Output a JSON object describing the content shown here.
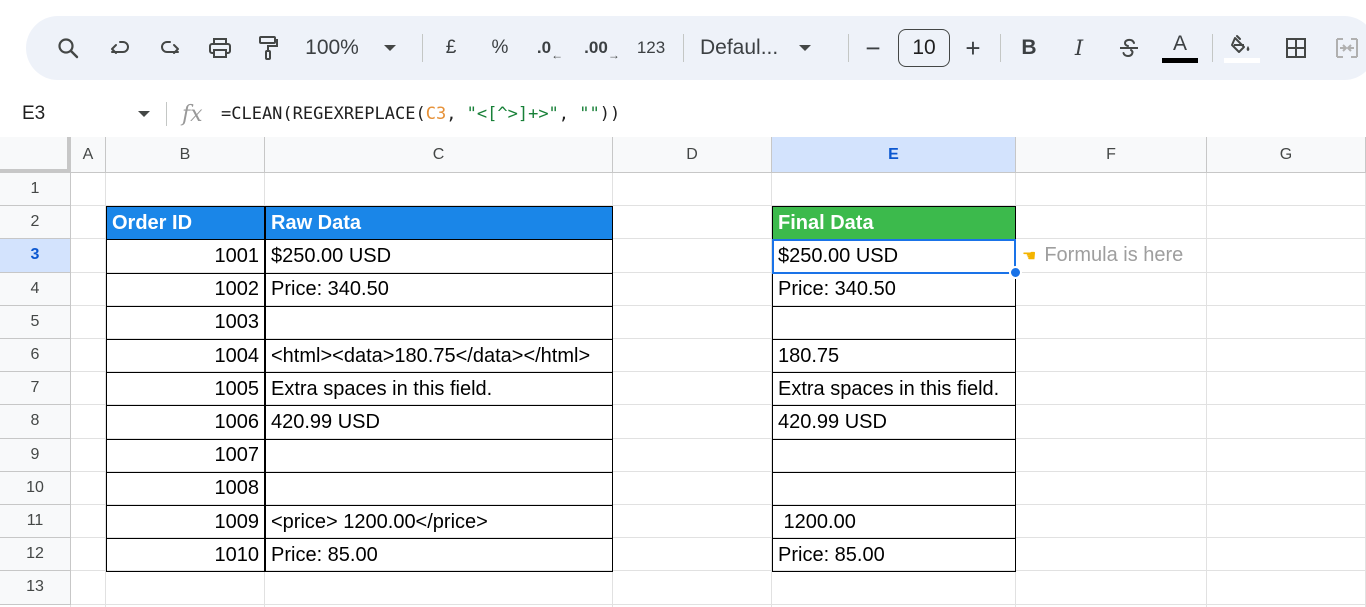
{
  "toolbar": {
    "zoom": "100%",
    "currency": "£",
    "percent": "%",
    "decrease_decimal": ".0",
    "increase_decimal": ".00",
    "number_format": "123",
    "font": "Defaul...",
    "font_size": "10",
    "bold": "B",
    "italic": "I",
    "text_color_glyph": "A",
    "minus": "−",
    "plus": "+"
  },
  "formula_bar": {
    "name_box": "E3",
    "fx": "fx",
    "formula_pre": "=CLEAN(REGEXREPLACE(",
    "formula_ref": "C3",
    "formula_mid": ", ",
    "formula_str1": "\"<[^>]+>\"",
    "formula_sep": ", ",
    "formula_str2": "\"\"",
    "formula_post": "))"
  },
  "columns": [
    "A",
    "B",
    "C",
    "D",
    "E",
    "F",
    "G"
  ],
  "selected_column": "E",
  "rows": [
    "1",
    "2",
    "3",
    "4",
    "5",
    "6",
    "7",
    "8",
    "9",
    "10",
    "11",
    "12",
    "13"
  ],
  "selected_row": "3",
  "headers": {
    "order_id": "Order ID",
    "raw_data": "Raw Data",
    "final_data": "Final Data"
  },
  "data_rows": [
    {
      "id": "1001",
      "raw": "$250.00 USD",
      "final": "$250.00 USD"
    },
    {
      "id": "1002",
      "raw": "Price: 340.50",
      "final": "Price: 340.50"
    },
    {
      "id": "1003",
      "raw": "",
      "final": ""
    },
    {
      "id": "1004",
      "raw": "<html><data>180.75</data></html>",
      "final": "180.75"
    },
    {
      "id": "1005",
      "raw": "Extra spaces in this field.",
      "final": "Extra spaces in this field."
    },
    {
      "id": "1006",
      "raw": "420.99 USD",
      "final": "420.99 USD"
    },
    {
      "id": "1007",
      "raw": "",
      "final": ""
    },
    {
      "id": "1008",
      "raw": "",
      "final": ""
    },
    {
      "id": "1009",
      "raw": "<price> 1200.00</price>",
      "final": " 1200.00"
    },
    {
      "id": "1010",
      "raw": "Price: 85.00",
      "final": "Price: 85.00"
    }
  ],
  "annotation": {
    "text": "Formula is here",
    "icon": "pointing-hand-icon"
  },
  "colors": {
    "header_blue": "#1a86e8",
    "header_green": "#3cba4c",
    "selection": "#1a73e8",
    "formula_ref": "#e69138",
    "formula_string": "#188038"
  }
}
